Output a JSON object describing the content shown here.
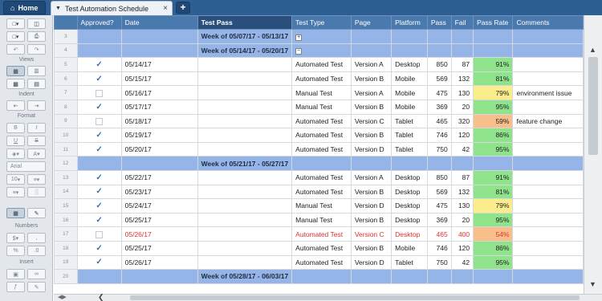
{
  "tabs": {
    "home_label": "Home",
    "doc_title": "Test Automation Schedule",
    "close_glyph": "×",
    "add_glyph": "+"
  },
  "toolbar": {
    "views_label": "Views",
    "indent_label": "Indent",
    "format_label": "Format",
    "font_name": "Arial",
    "font_size": "10",
    "numbers_label": "Numbers",
    "insert_label": "Insert",
    "icons": [
      "new-sheet-icon",
      "save-icon",
      "attach-icon",
      "print-icon",
      "undo-icon",
      "redo-icon",
      "grid-view-icon",
      "gantt-view-icon",
      "card-view-icon",
      "calendar-view-icon",
      "outdent-icon",
      "indent-icon",
      "bold-icon",
      "italic-icon",
      "underline-icon",
      "strikethrough-icon",
      "fill-color-icon",
      "text-color-icon",
      "align-left-icon",
      "wrap-icon",
      "highlight-icon",
      "format-painter-icon",
      "currency-icon",
      "comma-icon",
      "percent-icon",
      "decimal-icon",
      "insert-image-icon",
      "insert-link-icon"
    ]
  },
  "columns": [
    "Approved?",
    "Date",
    "Test Pass",
    "Test Type",
    "Page",
    "Platform",
    "Pass",
    "Fail",
    "Pass Rate",
    "Comments"
  ],
  "colors": {
    "rate_green": "#8fe38b",
    "rate_yellow": "#fbec8c",
    "rate_orange": "#f9bf8a",
    "week_row": "#95b5e8",
    "header": "#4a79ad",
    "red_text": "#e03030"
  },
  "rows": [
    {
      "num": "3",
      "type": "week",
      "title": "Week of 05/07/17 - 05/13/17",
      "expander": "+"
    },
    {
      "num": "4",
      "type": "week",
      "title": "Week of 05/14/17 - 05/20/17",
      "expander": "−"
    },
    {
      "num": "5",
      "type": "data",
      "approved": true,
      "date": "05/14/17",
      "test_type": "Automated Test",
      "page": "Version A",
      "platform": "Desktop",
      "pass": "850",
      "fail": "87",
      "rate": "91%",
      "rate_color": "green",
      "comment": ""
    },
    {
      "num": "6",
      "type": "data",
      "approved": true,
      "date": "05/15/17",
      "test_type": "Automated Test",
      "page": "Version B",
      "platform": "Mobile",
      "pass": "569",
      "fail": "132",
      "rate": "81%",
      "rate_color": "green",
      "comment": ""
    },
    {
      "num": "7",
      "type": "data",
      "approved": false,
      "date": "05/16/17",
      "test_type": "Manual Test",
      "page": "Version A",
      "platform": "Mobile",
      "pass": "475",
      "fail": "130",
      "rate": "79%",
      "rate_color": "yellow",
      "comment": "environment issue"
    },
    {
      "num": "8",
      "type": "data",
      "approved": true,
      "date": "05/17/17",
      "test_type": "Manual Test",
      "page": "Version B",
      "platform": "Mobile",
      "pass": "369",
      "fail": "20",
      "rate": "95%",
      "rate_color": "green",
      "comment": ""
    },
    {
      "num": "9",
      "type": "data",
      "approved": false,
      "date": "05/18/17",
      "test_type": "Automated Test",
      "page": "Version C",
      "platform": "Tablet",
      "pass": "465",
      "fail": "320",
      "rate": "59%",
      "rate_color": "orange",
      "comment": "feature change"
    },
    {
      "num": "10",
      "type": "data",
      "approved": true,
      "date": "05/19/17",
      "test_type": "Automated Test",
      "page": "Version B",
      "platform": "Tablet",
      "pass": "746",
      "fail": "120",
      "rate": "86%",
      "rate_color": "green",
      "comment": ""
    },
    {
      "num": "11",
      "type": "data",
      "approved": true,
      "date": "05/20/17",
      "test_type": "Automated Test",
      "page": "Version D",
      "platform": "Tablet",
      "pass": "750",
      "fail": "42",
      "rate": "95%",
      "rate_color": "green",
      "comment": ""
    },
    {
      "num": "12",
      "type": "week",
      "title": "Week of 05/21/17 - 05/27/17",
      "expander": ""
    },
    {
      "num": "13",
      "type": "data",
      "approved": true,
      "date": "05/22/17",
      "test_type": "Automated Test",
      "page": "Version A",
      "platform": "Desktop",
      "pass": "850",
      "fail": "87",
      "rate": "91%",
      "rate_color": "green",
      "comment": ""
    },
    {
      "num": "14",
      "type": "data",
      "approved": true,
      "date": "05/23/17",
      "test_type": "Automated Test",
      "page": "Version B",
      "platform": "Desktop",
      "pass": "569",
      "fail": "132",
      "rate": "81%",
      "rate_color": "green",
      "comment": ""
    },
    {
      "num": "15",
      "type": "data",
      "approved": true,
      "date": "05/24/17",
      "test_type": "Manual Test",
      "page": "Version D",
      "platform": "Desktop",
      "pass": "475",
      "fail": "130",
      "rate": "79%",
      "rate_color": "yellow",
      "comment": ""
    },
    {
      "num": "16",
      "type": "data",
      "approved": true,
      "date": "05/25/17",
      "test_type": "Manual Test",
      "page": "Version B",
      "platform": "Desktop",
      "pass": "369",
      "fail": "20",
      "rate": "95%",
      "rate_color": "green",
      "comment": ""
    },
    {
      "num": "17",
      "type": "data",
      "approved": false,
      "red": true,
      "date": "05/26/17",
      "test_type": "Automated Test",
      "page": "Version C",
      "platform": "Desktop",
      "pass": "465",
      "fail": "400",
      "rate": "54%",
      "rate_color": "orange",
      "comment": ""
    },
    {
      "num": "18",
      "type": "data",
      "approved": true,
      "date": "05/25/17",
      "test_type": "Automated Test",
      "page": "Version B",
      "platform": "Mobile",
      "pass": "746",
      "fail": "120",
      "rate": "86%",
      "rate_color": "green",
      "comment": ""
    },
    {
      "num": "19",
      "type": "data",
      "approved": true,
      "date": "05/26/17",
      "test_type": "Automated Test",
      "page": "Version D",
      "platform": "Tablet",
      "pass": "750",
      "fail": "42",
      "rate": "95%",
      "rate_color": "green",
      "comment": ""
    },
    {
      "num": "20",
      "type": "week",
      "title": "Week of 05/28/17 - 06/03/17",
      "expander": ""
    }
  ]
}
